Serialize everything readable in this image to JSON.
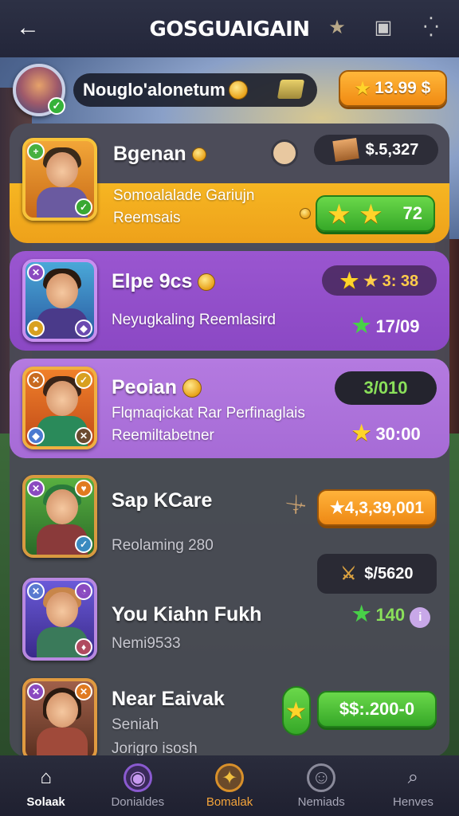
{
  "header": {
    "back_icon": "arrow-left-icon",
    "title": "GOSGUAIGAIN",
    "icons": [
      "star-icon",
      "calendar-icon",
      "more-icon"
    ]
  },
  "profile": {
    "name": "Nouglo'alonetum",
    "currency_value": "13.99 $"
  },
  "cards": [
    {
      "name": "Bgenan",
      "subtitle_1": "Somoalalade Gariujn",
      "subtitle_2": "Reemsais",
      "stat_top": "$.5,327",
      "rating_stars": 2,
      "rating_value": "72"
    },
    {
      "name": "Elpe 9cs",
      "subtitle_1": "Neyugkaling Reemlasird",
      "stat_top": "★ 3: 38",
      "stat_bottom": "17/09"
    },
    {
      "name": "Peoian",
      "subtitle_1": "Flqmaqickat Rar Perfinaglais",
      "subtitle_2": "Reemiltabetner",
      "stat_top": "3/010",
      "stat_bottom": "30:00"
    },
    {
      "name": "Sap KCare",
      "subtitle_1": "Reolaming 280",
      "stat_top": "★4,3,39,001",
      "stat_bottom": "$/5620"
    },
    {
      "name": "You Kiahn Fukh",
      "subtitle_1": "Nemi9533",
      "stat_top": "140"
    },
    {
      "name": "Near Eaivak",
      "subtitle_1": "Seniah",
      "subtitle_2": "Jorigro isosh",
      "stat_top": "$$:.200-0"
    }
  ],
  "nav": [
    {
      "label": "Solaak",
      "icon": "home-icon"
    },
    {
      "label": "Donialdes",
      "icon": "shield-icon"
    },
    {
      "label": "Bomalak",
      "icon": "star-badge-icon"
    },
    {
      "label": "Nemiads",
      "icon": "face-icon"
    },
    {
      "label": "Henves",
      "icon": "search-icon"
    }
  ],
  "colors": {
    "gold": "#f4b222",
    "purple": "#9a56d0",
    "light_purple": "#b47ae0",
    "green_button": "#36a828",
    "orange_button": "#f08a12"
  }
}
